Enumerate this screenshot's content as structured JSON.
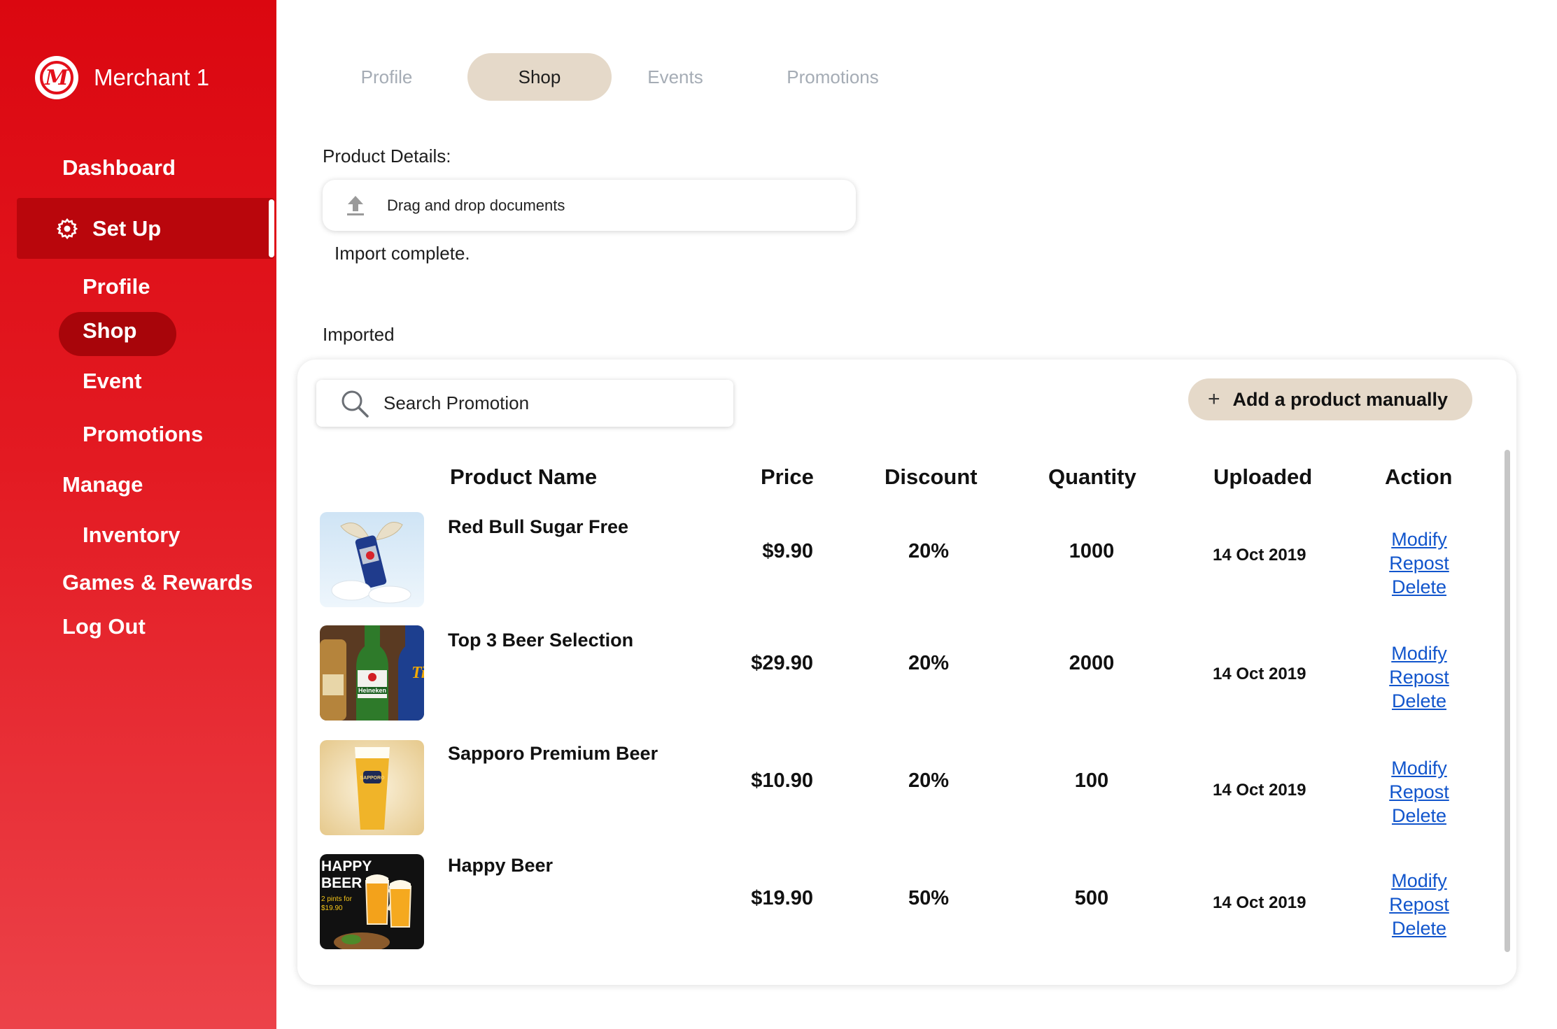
{
  "sidebar": {
    "merchant_name": "Merchant 1",
    "logo_letter": "M",
    "nav": {
      "dashboard": "Dashboard",
      "setup": "Set Up",
      "profile": "Profile",
      "shop": "Shop",
      "event": "Event",
      "promotions": "Promotions",
      "manage": "Manage",
      "inventory": "Inventory",
      "games_rewards": "Games & Rewards",
      "logout": "Log Out"
    },
    "active_item": "Set Up",
    "active_subitem": "Shop"
  },
  "tabs": [
    {
      "label": "Profile",
      "active": false
    },
    {
      "label": "Shop",
      "active": true
    },
    {
      "label": "Events",
      "active": false
    },
    {
      "label": "Promotions",
      "active": false
    }
  ],
  "upload": {
    "section_label": "Product Details:",
    "dropzone_text": "Drag and drop documents",
    "status": "Import complete."
  },
  "imported": {
    "section_label": "Imported",
    "search_placeholder": "Search Promotion",
    "add_button": "Add a product manually",
    "columns": {
      "name": "Product Name",
      "price": "Price",
      "discount": "Discount",
      "quantity": "Quantity",
      "uploaded": "Uploaded",
      "action": "Action"
    },
    "rows": [
      {
        "name": "Red Bull Sugar Free",
        "price": "$9.90",
        "discount": "20%",
        "quantity": "1000",
        "uploaded": "14 Oct 2019"
      },
      {
        "name": "Top 3 Beer Selection",
        "price": "$29.90",
        "discount": "20%",
        "quantity": "2000",
        "uploaded": "14 Oct 2019"
      },
      {
        "name": "Sapporo Premium Beer",
        "price": "$10.90",
        "discount": "20%",
        "quantity": "100",
        "uploaded": "14 Oct 2019"
      },
      {
        "name": "Happy Beer",
        "price": "$19.90",
        "discount": "50%",
        "quantity": "500",
        "uploaded": "14 Oct 2019"
      }
    ],
    "actions": {
      "modify": "Modify",
      "repost": "Repost",
      "delete": "Delete"
    },
    "thumb_text": {
      "heineken": "Heineken",
      "sapporo": "SAPPORO",
      "happy_line1": "HAPPY",
      "happy_line2": "BEER",
      "happy_line3": "2 pints for",
      "happy_line4": "$19.90"
    }
  },
  "colors": {
    "brand_red": "#e3101a",
    "active_nav": "#b9060c",
    "tab_active_bg": "#e5d9c9",
    "link_blue": "#1155cc"
  }
}
